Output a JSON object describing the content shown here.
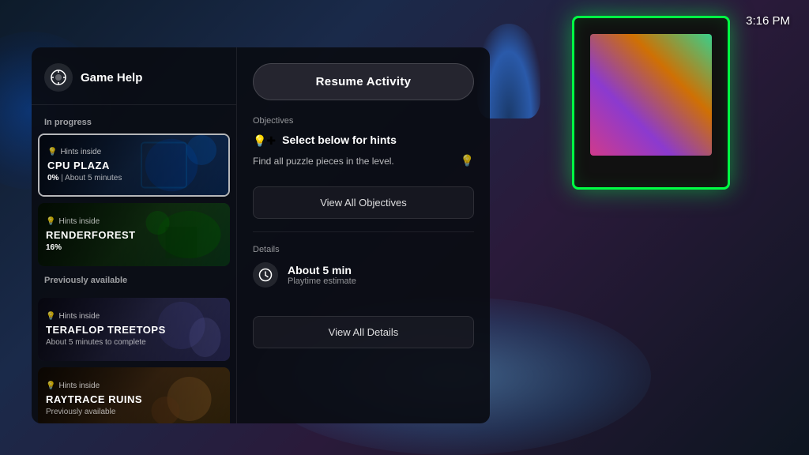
{
  "clock": "3:16 PM",
  "gameHelp": {
    "title": "Game Help",
    "iconLabel": "🎮"
  },
  "sidebar": {
    "inProgressLabel": "In progress",
    "previouslyAvailableLabel": "Previously available",
    "activities": [
      {
        "id": "cpu-plaza",
        "hintsLabel": "Hints inside",
        "name": "CPU PLAZA",
        "progress": "0%",
        "progressSuffix": " | About 5 minutes",
        "active": true,
        "bgClass": "activity-card-bg-cpu"
      },
      {
        "id": "renderforest",
        "hintsLabel": "Hints inside",
        "name": "RENDERFOREST",
        "progress": "16%",
        "progressSuffix": "",
        "active": false,
        "bgClass": "activity-card-bg-render"
      },
      {
        "id": "teraflop-treetops",
        "hintsLabel": "Hints inside",
        "name": "TERAFLOP TREETOPS",
        "progress": "About 5 minutes to complete",
        "progressSuffix": "",
        "active": false,
        "bgClass": "activity-card-bg-tera"
      },
      {
        "id": "raytrace-ruins",
        "hintsLabel": "Hints inside",
        "name": "RAYTRACE RUINS",
        "progress": "Previously available",
        "progressSuffix": "",
        "active": false,
        "bgClass": "activity-card-bg-ray"
      }
    ]
  },
  "mainContent": {
    "resumeButton": "Resume Activity",
    "objectivesSection": {
      "label": "Objectives",
      "selectedHintLabel": "Select below for hints",
      "objectiveDesc": "Find all puzzle pieces in the level.",
      "viewAllButton": "View All Objectives"
    },
    "detailsSection": {
      "label": "Details",
      "playtime": "About 5 min",
      "playtimeLabel": "Playtime estimate",
      "viewAllButton": "View All Details"
    }
  }
}
